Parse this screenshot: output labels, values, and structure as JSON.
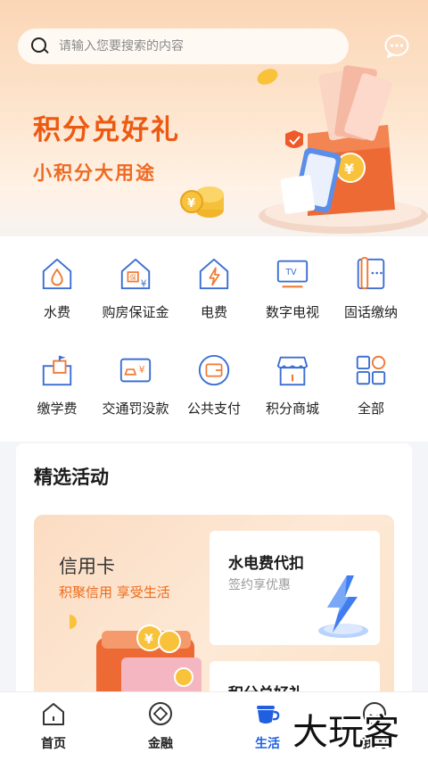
{
  "search": {
    "placeholder": "请输入您要搜索的内容",
    "icon": "search-icon"
  },
  "header": {
    "message_icon": "chat-bubble-icon"
  },
  "banner": {
    "title": "积分兑好礼",
    "subtitle": "小积分大用途",
    "accent": "#ec5a12"
  },
  "services": [
    {
      "label": "水费",
      "icon": "water-house-icon"
    },
    {
      "label": "购房保证金",
      "icon": "house-deposit-icon"
    },
    {
      "label": "电费",
      "icon": "electric-house-icon"
    },
    {
      "label": "数字电视",
      "icon": "tv-icon"
    },
    {
      "label": "固话缴纳",
      "icon": "landline-phone-icon"
    },
    {
      "label": "缴学费",
      "icon": "school-icon"
    },
    {
      "label": "交通罚没款",
      "icon": "traffic-fine-icon"
    },
    {
      "label": "公共支付",
      "icon": "wallet-icon"
    },
    {
      "label": "积分商城",
      "icon": "store-icon"
    },
    {
      "label": "全部",
      "icon": "all-grid-icon"
    }
  ],
  "activities": {
    "title": "精选活动",
    "promo": {
      "title": "信用卡",
      "subtitle": "积聚信用 享受生活"
    },
    "cards": [
      {
        "title": "水电费代扣",
        "subtitle": "签约享优惠"
      },
      {
        "title": "积分兑好礼"
      }
    ]
  },
  "bottom_nav": {
    "items": [
      {
        "label": "首页",
        "icon": "home-icon",
        "active": false
      },
      {
        "label": "金融",
        "icon": "finance-icon",
        "active": false
      },
      {
        "label": "生活",
        "icon": "coffee-cup-icon",
        "active": true
      },
      {
        "label": "我的",
        "icon": "profile-icon",
        "active": false
      }
    ],
    "active_color": "#1f5fe0"
  },
  "watermark": {
    "text": "大玩客"
  }
}
